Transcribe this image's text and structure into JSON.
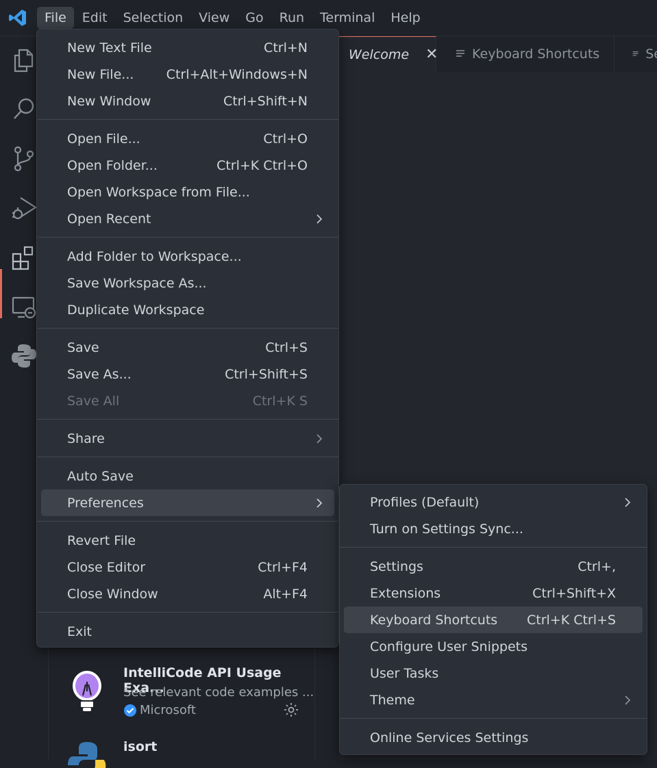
{
  "menubar": [
    "File",
    "Edit",
    "Selection",
    "View",
    "Go",
    "Run",
    "Terminal",
    "Help"
  ],
  "tabs": [
    {
      "label": "Welcome",
      "active": true,
      "close": "✕"
    },
    {
      "label": "Keyboard Shortcuts",
      "active": false
    },
    {
      "label": "Se",
      "active": false
    }
  ],
  "file_menu": [
    {
      "label": "New Text File",
      "shortcut": "Ctrl+N"
    },
    {
      "label": "New File...",
      "shortcut": "Ctrl+Alt+Windows+N"
    },
    {
      "label": "New Window",
      "shortcut": "Ctrl+Shift+N"
    },
    {
      "label": "Open File...",
      "shortcut": "Ctrl+O"
    },
    {
      "label": "Open Folder...",
      "shortcut": "Ctrl+K Ctrl+O"
    },
    {
      "label": "Open Workspace from File...",
      "shortcut": ""
    },
    {
      "label": "Open Recent",
      "shortcut": "",
      "submenu": true
    },
    {
      "label": "Add Folder to Workspace...",
      "shortcut": ""
    },
    {
      "label": "Save Workspace As...",
      "shortcut": ""
    },
    {
      "label": "Duplicate Workspace",
      "shortcut": ""
    },
    {
      "label": "Save",
      "shortcut": "Ctrl+S"
    },
    {
      "label": "Save As...",
      "shortcut": "Ctrl+Shift+S"
    },
    {
      "label": "Save All",
      "shortcut": "Ctrl+K S",
      "disabled": true
    },
    {
      "label": "Share",
      "shortcut": "",
      "submenu": true
    },
    {
      "label": "Auto Save",
      "shortcut": ""
    },
    {
      "label": "Preferences",
      "shortcut": "",
      "submenu": true,
      "highlighted": true
    },
    {
      "label": "Revert File",
      "shortcut": ""
    },
    {
      "label": "Close Editor",
      "shortcut": "Ctrl+F4"
    },
    {
      "label": "Close Window",
      "shortcut": "Alt+F4"
    },
    {
      "label": "Exit",
      "shortcut": ""
    }
  ],
  "preferences_menu": [
    {
      "label": "Profiles (Default)",
      "shortcut": "",
      "submenu": true
    },
    {
      "label": "Turn on Settings Sync...",
      "shortcut": ""
    },
    {
      "label": "Settings",
      "shortcut": "Ctrl+,"
    },
    {
      "label": "Extensions",
      "shortcut": "Ctrl+Shift+X"
    },
    {
      "label": "Keyboard Shortcuts",
      "shortcut": "Ctrl+K Ctrl+S",
      "highlighted": true
    },
    {
      "label": "Configure User Snippets",
      "shortcut": ""
    },
    {
      "label": "User Tasks",
      "shortcut": ""
    },
    {
      "label": "Theme",
      "shortcut": "",
      "submenu": true
    },
    {
      "label": "Online Services Settings",
      "shortcut": ""
    }
  ],
  "extensions": [
    {
      "title": "IntelliCode API Usage Exa...",
      "description": "See relevant code examples ...",
      "publisher": "Microsoft",
      "icon": "lightbulb-icon"
    },
    {
      "title": "isort",
      "icon": "python-icon"
    }
  ],
  "colors": {
    "accent": "#e06c5e",
    "vscode_blue": "#3e9be8",
    "verified": "#3794ff"
  }
}
